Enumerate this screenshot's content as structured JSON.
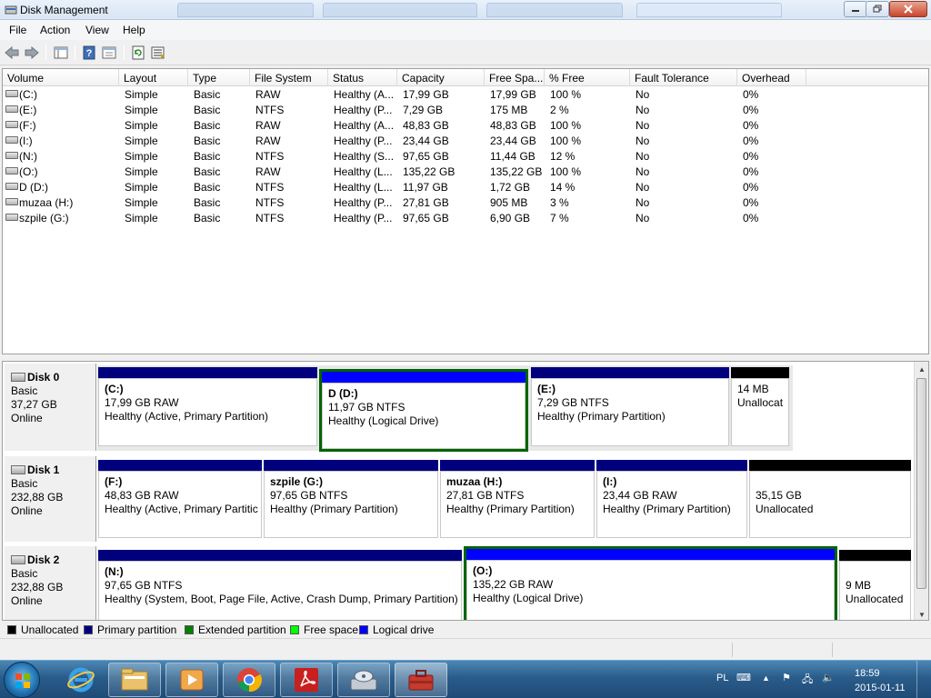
{
  "window": {
    "title": "Disk Management",
    "controls": [
      "minimize",
      "maximize",
      "close"
    ]
  },
  "menu": {
    "items": [
      "File",
      "Action",
      "View",
      "Help"
    ]
  },
  "toolbar": {
    "buttons": [
      "back-arrow-icon",
      "forward-arrow-icon",
      "console-tree-icon",
      "help-icon",
      "properties-icon",
      "refresh-icon",
      "export-list-icon"
    ]
  },
  "volume_list": {
    "columns": [
      "Volume",
      "Layout",
      "Type",
      "File System",
      "Status",
      "Capacity",
      "Free Spa...",
      "% Free",
      "Fault Tolerance",
      "Overhead"
    ],
    "rows": [
      {
        "volume": "(C:)",
        "layout": "Simple",
        "type": "Basic",
        "fs": "RAW",
        "status": "Healthy (A...",
        "capacity": "17,99 GB",
        "free": "17,99 GB",
        "pct": "100 %",
        "fault": "No",
        "overhead": "0%"
      },
      {
        "volume": "(E:)",
        "layout": "Simple",
        "type": "Basic",
        "fs": "NTFS",
        "status": "Healthy (P...",
        "capacity": "7,29 GB",
        "free": "175 MB",
        "pct": "2 %",
        "fault": "No",
        "overhead": "0%"
      },
      {
        "volume": "(F:)",
        "layout": "Simple",
        "type": "Basic",
        "fs": "RAW",
        "status": "Healthy (A...",
        "capacity": "48,83 GB",
        "free": "48,83 GB",
        "pct": "100 %",
        "fault": "No",
        "overhead": "0%"
      },
      {
        "volume": "(I:)",
        "layout": "Simple",
        "type": "Basic",
        "fs": "RAW",
        "status": "Healthy (P...",
        "capacity": "23,44 GB",
        "free": "23,44 GB",
        "pct": "100 %",
        "fault": "No",
        "overhead": "0%"
      },
      {
        "volume": "(N:)",
        "layout": "Simple",
        "type": "Basic",
        "fs": "NTFS",
        "status": "Healthy (S...",
        "capacity": "97,65 GB",
        "free": "11,44 GB",
        "pct": "12 %",
        "fault": "No",
        "overhead": "0%"
      },
      {
        "volume": "(O:)",
        "layout": "Simple",
        "type": "Basic",
        "fs": "RAW",
        "status": "Healthy (L...",
        "capacity": "135,22 GB",
        "free": "135,22 GB",
        "pct": "100 %",
        "fault": "No",
        "overhead": "0%"
      },
      {
        "volume": "D (D:)",
        "layout": "Simple",
        "type": "Basic",
        "fs": "NTFS",
        "status": "Healthy (L...",
        "capacity": "11,97 GB",
        "free": "1,72 GB",
        "pct": "14 %",
        "fault": "No",
        "overhead": "0%"
      },
      {
        "volume": "muzaa (H:)",
        "layout": "Simple",
        "type": "Basic",
        "fs": "NTFS",
        "status": "Healthy (P...",
        "capacity": "27,81 GB",
        "free": "905 MB",
        "pct": "3 %",
        "fault": "No",
        "overhead": "0%"
      },
      {
        "volume": "szpile (G:)",
        "layout": "Simple",
        "type": "Basic",
        "fs": "NTFS",
        "status": "Healthy (P...",
        "capacity": "97,65 GB",
        "free": "6,90 GB",
        "pct": "7 %",
        "fault": "No",
        "overhead": "0%"
      }
    ]
  },
  "disks": [
    {
      "name": "Disk 0",
      "type": "Basic",
      "size": "37,27 GB",
      "state": "Online",
      "partitions": [
        {
          "kind": "primary",
          "name": "(C:)",
          "line1": "17,99 GB RAW",
          "line2": "Healthy (Active, Primary Partition)"
        },
        {
          "kind": "logical",
          "name": "D  (D:)",
          "line1": "11,97 GB NTFS",
          "line2": "Healthy (Logical Drive)",
          "extended": true
        },
        {
          "kind": "primary",
          "name": "(E:)",
          "line1": "7,29 GB NTFS",
          "line2": "Healthy (Primary Partition)"
        },
        {
          "kind": "unallocated",
          "name": "",
          "line1": "14 MB",
          "line2": "Unallocat"
        }
      ]
    },
    {
      "name": "Disk 1",
      "type": "Basic",
      "size": "232,88 GB",
      "state": "Online",
      "partitions": [
        {
          "kind": "primary",
          "name": "(F:)",
          "line1": "48,83 GB RAW",
          "line2": "Healthy (Active, Primary Partitic"
        },
        {
          "kind": "primary",
          "name": "szpile  (G:)",
          "line1": "97,65 GB NTFS",
          "line2": "Healthy (Primary Partition)"
        },
        {
          "kind": "primary",
          "name": "muzaa  (H:)",
          "line1": "27,81 GB NTFS",
          "line2": "Healthy (Primary Partition)"
        },
        {
          "kind": "primary",
          "name": "(I:)",
          "line1": "23,44 GB RAW",
          "line2": "Healthy (Primary Partition)"
        },
        {
          "kind": "unallocated",
          "name": "",
          "line1": "35,15 GB",
          "line2": "Unallocated"
        }
      ]
    },
    {
      "name": "Disk 2",
      "type": "Basic",
      "size": "232,88 GB",
      "state": "Online",
      "partitions": [
        {
          "kind": "primary",
          "name": "(N:)",
          "line1": "97,65 GB NTFS",
          "line2": "Healthy (System, Boot, Page File, Active, Crash Dump, Primary Partition)"
        },
        {
          "kind": "logical",
          "name": "(O:)",
          "line1": "135,22 GB RAW",
          "line2": "Healthy (Logical Drive)",
          "extended": true
        },
        {
          "kind": "unallocated",
          "name": "",
          "line1": "9 MB",
          "line2": "Unallocated"
        }
      ]
    }
  ],
  "legend": [
    {
      "label": "Unallocated",
      "color": "#000000"
    },
    {
      "label": "Primary partition",
      "color": "#00007f"
    },
    {
      "label": "Extended partition",
      "color": "#008000"
    },
    {
      "label": "Free space",
      "color": "#00ff00"
    },
    {
      "label": "Logical drive",
      "color": "#0000ff"
    }
  ],
  "colors": {
    "primary": "#00007f",
    "logical": "#0000ff",
    "unallocated": "#000000",
    "extended_border": "#006400"
  },
  "taskbar": {
    "apps": [
      "internet-explorer-icon",
      "file-explorer-icon",
      "media-player-icon",
      "chrome-icon",
      "acrobat-icon",
      "disk-management-icon",
      "toolbox-icon"
    ],
    "tray": {
      "language": "PL",
      "time": "18:59",
      "date": "2015-01-11"
    }
  }
}
